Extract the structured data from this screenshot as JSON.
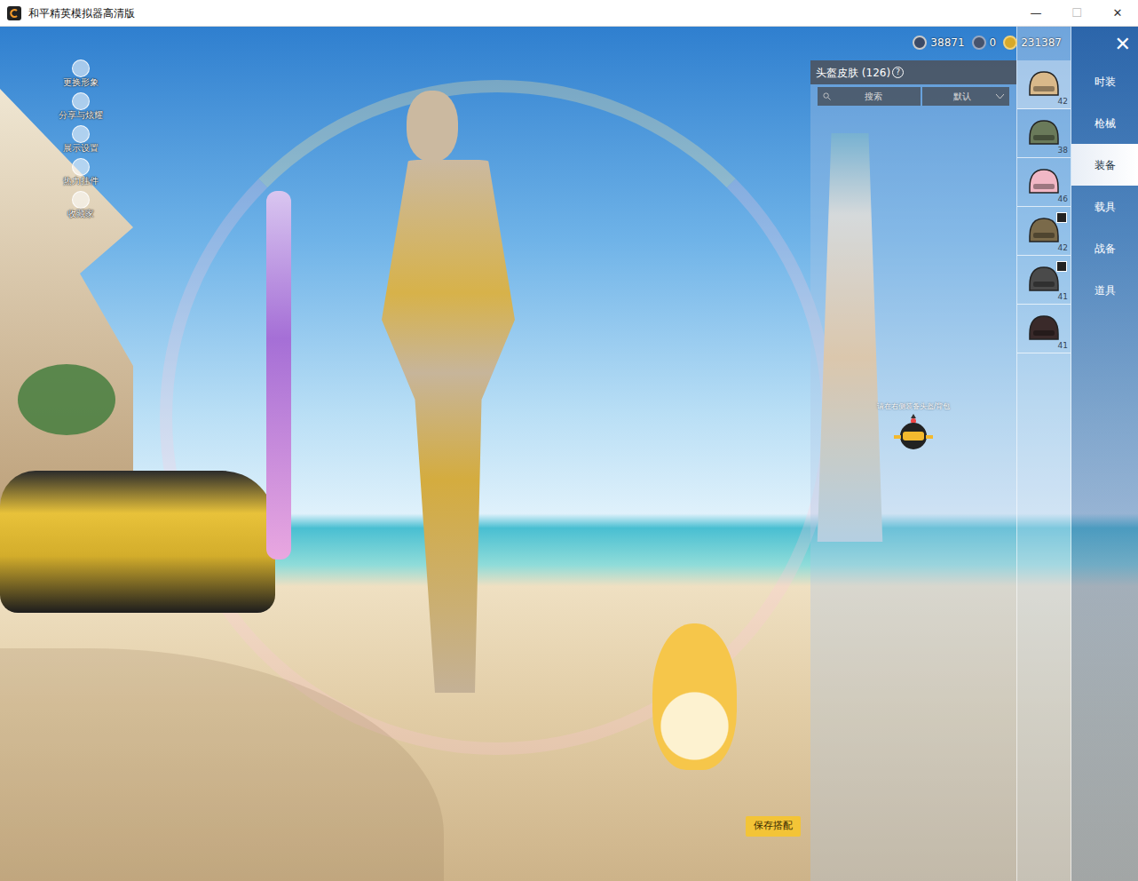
{
  "window": {
    "title": "和平精英模拟器高清版",
    "controls": [
      "—",
      "☐",
      "✕"
    ]
  },
  "currencies": [
    {
      "amount": "38871"
    },
    {
      "amount": "0"
    },
    {
      "amount": "231387"
    }
  ],
  "side_menu": [
    {
      "label": "更换形象"
    },
    {
      "label": "分享与炫耀"
    },
    {
      "label": "展示设置"
    },
    {
      "label": "热力挂件"
    },
    {
      "label": "收藏家"
    }
  ],
  "panel": {
    "title": "头盔皮肤 (126)",
    "help": "?",
    "search": "搜索",
    "sort": "默认",
    "hint": "请在右侧装备头盔/背包"
  },
  "slots": [
    {
      "count": "42",
      "selected": true,
      "tagged": false
    },
    {
      "count": "38",
      "selected": false,
      "tagged": false
    },
    {
      "count": "46",
      "selected": false,
      "tagged": false
    },
    {
      "count": "42",
      "selected": false,
      "tagged": true
    },
    {
      "count": "41",
      "selected": false,
      "tagged": true
    },
    {
      "count": "41",
      "selected": false,
      "tagged": false
    }
  ],
  "categories": [
    {
      "label": "时装",
      "selected": false
    },
    {
      "label": "枪械",
      "selected": false
    },
    {
      "label": "装备",
      "selected": true
    },
    {
      "label": "载具",
      "selected": false
    },
    {
      "label": "战备",
      "selected": false
    },
    {
      "label": "道具",
      "selected": false
    }
  ],
  "close": "✕",
  "save_button": "保存搭配"
}
